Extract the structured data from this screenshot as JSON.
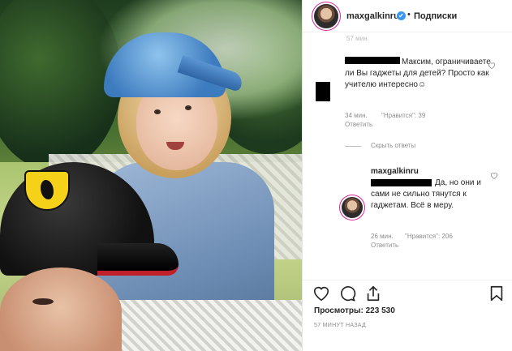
{
  "post": {
    "username": "maxgalkinru",
    "verified_mark": "✔",
    "separator": "•",
    "follow_label": "Подписки",
    "top_cut_text": "57 мин."
  },
  "comments": [
    {
      "text": "Максим, ограничиваете ли Вы гаджеты для детей? Просто как учителю интересно☺",
      "time": "34 мин.",
      "likes": "\"Нравится\": 39",
      "reply": "Ответить"
    }
  ],
  "hide_replies": "Скрыть ответы",
  "reply_comment": {
    "username": "maxgalkinru",
    "text": "Да, но они и сами не сильно тянутся к гаджетам. Всё в меру.",
    "time": "26 мин.",
    "likes": "\"Нравится\": 206",
    "reply": "Ответить"
  },
  "stats": {
    "views_label": "Просмотры:",
    "views_value": "223 530",
    "posted_ago": "57 МИНУТ НАЗАД"
  },
  "icons": {
    "heart": "heart-icon",
    "comment": "comment-icon",
    "share": "share-icon",
    "bookmark": "bookmark-icon"
  },
  "colors": {
    "verified": "#3897f0",
    "meta": "#8e8e8e",
    "text": "#262626"
  }
}
